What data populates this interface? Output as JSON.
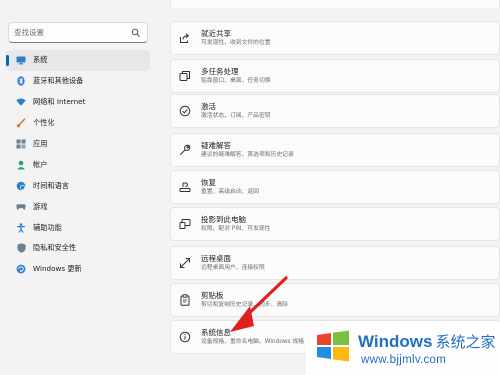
{
  "search": {
    "placeholder": "查找设置"
  },
  "sidebar": {
    "items": [
      {
        "label": "系统",
        "icon": "monitor-icon",
        "active": true
      },
      {
        "label": "蓝牙和其他设备",
        "icon": "bluetooth-icon"
      },
      {
        "label": "网络和 Internet",
        "icon": "wifi-icon"
      },
      {
        "label": "个性化",
        "icon": "brush-icon"
      },
      {
        "label": "应用",
        "icon": "apps-icon"
      },
      {
        "label": "帐户",
        "icon": "person-icon"
      },
      {
        "label": "时间和语言",
        "icon": "globe-clock-icon"
      },
      {
        "label": "游戏",
        "icon": "gamepad-icon"
      },
      {
        "label": "辅助功能",
        "icon": "accessibility-icon"
      },
      {
        "label": "隐私和安全性",
        "icon": "shield-icon"
      },
      {
        "label": "Windows 更新",
        "icon": "update-icon"
      }
    ]
  },
  "cards": [
    {
      "title": "就近共享",
      "desc": "可发现性、收到文件的位置",
      "icon": "share-icon"
    },
    {
      "title": "多任务处理",
      "desc": "贴靠窗口、桌面、任务切换",
      "icon": "multitask-icon"
    },
    {
      "title": "激活",
      "desc": "激活状态、订阅、产品密钥",
      "icon": "activation-check-icon"
    },
    {
      "title": "疑难解答",
      "desc": "建议的疑难解答、首选项和历史记录",
      "icon": "wrench-icon"
    },
    {
      "title": "恢复",
      "desc": "重置、高级启动、返回",
      "icon": "recovery-icon"
    },
    {
      "title": "投影到此电脑",
      "desc": "权限、配对 PIN、可发现性",
      "icon": "project-icon"
    },
    {
      "title": "远程桌面",
      "desc": "远程桌面用户、连接权限",
      "icon": "remote-desktop-icon"
    },
    {
      "title": "剪贴板",
      "desc": "剪切和复制历史记录、同步、清除",
      "icon": "clipboard-icon"
    },
    {
      "title": "系统信息",
      "desc": "设备规格、重命名电脑、Windows 规格",
      "icon": "info-icon"
    }
  ],
  "watermark": {
    "brand": "Windows",
    "brand_cn": "系统之家",
    "url": "www.bjjmlv.com"
  },
  "colors": {
    "accent": "#0067c0",
    "arrow": "#e02020",
    "watermark_blue": "#1f6fc4"
  }
}
